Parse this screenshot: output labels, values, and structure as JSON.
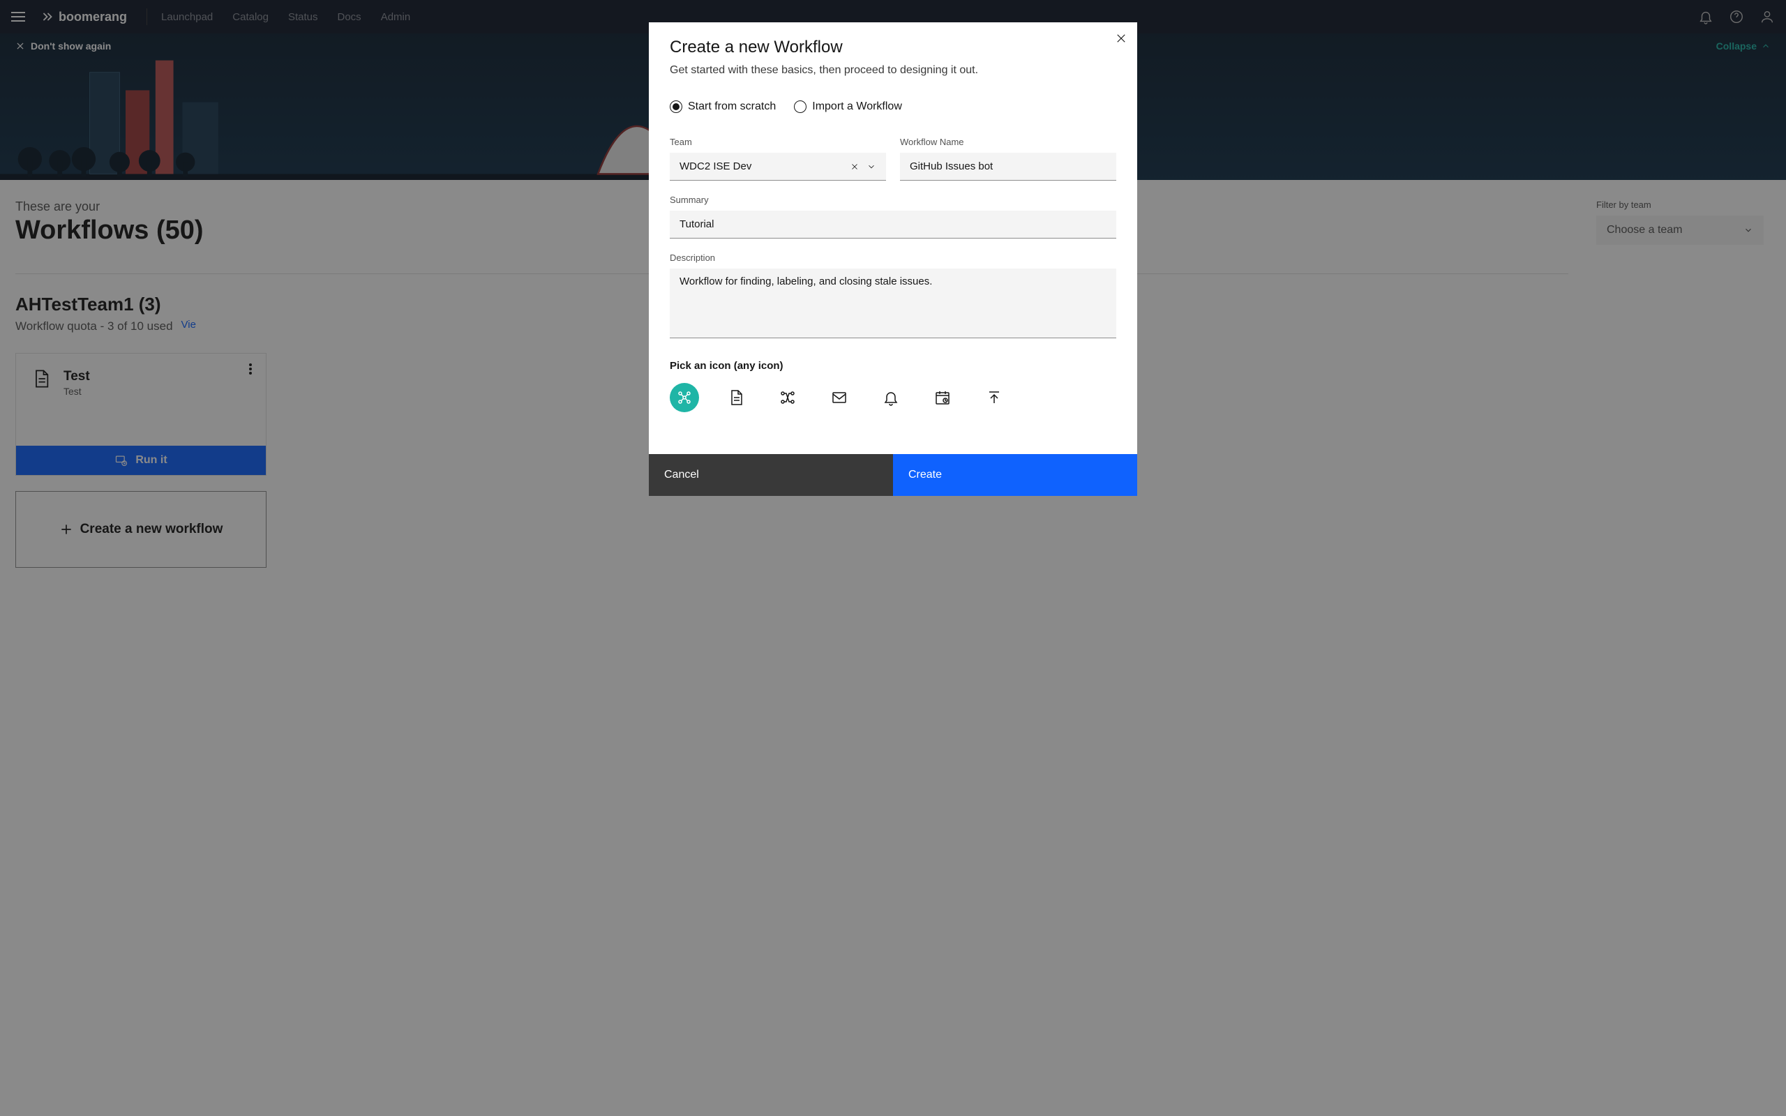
{
  "nav": {
    "brand": "boomerang",
    "links": [
      "Launchpad",
      "Catalog",
      "Status",
      "Docs",
      "Admin"
    ]
  },
  "banner": {
    "dont_show": "Don't show again",
    "collapse": "Collapse"
  },
  "page": {
    "subtitle": "These are your",
    "title": "Workflows (50)",
    "filter_label": "Filter by team",
    "filter_value": "Choose a team"
  },
  "section": {
    "name": "AHTestTeam1 (3)",
    "quota": "Workflow quota - 3 of 10 used",
    "view": "Vie",
    "card": {
      "title": "Test",
      "sub": "Test"
    },
    "run": "Run it",
    "create_new": "Create a new workflow"
  },
  "modal": {
    "title": "Create a new Workflow",
    "sub": "Get started with these basics, then proceed to designing it out.",
    "radio_scratch": "Start from scratch",
    "radio_import": "Import a Workflow",
    "team_label": "Team",
    "team_value": "WDC2 ISE Dev",
    "name_label": "Workflow Name",
    "name_value": "GitHub Issues bot",
    "summary_label": "Summary",
    "summary_value": "Tutorial",
    "desc_label": "Description",
    "desc_value": "Workflow for finding, labeling, and closing stale issues.",
    "pick_label": "Pick an icon (any icon)",
    "cancel": "Cancel",
    "create": "Create"
  }
}
